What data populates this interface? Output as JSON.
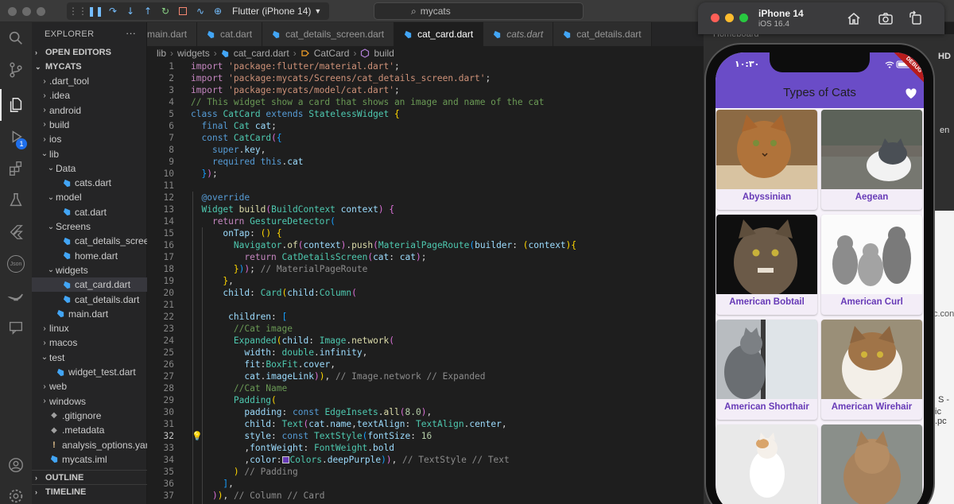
{
  "titlebar": {
    "device": "Flutter (iPhone 14)",
    "search_text": "mycats"
  },
  "activity": {
    "run_badge": "1",
    "json_label": "Json"
  },
  "sidebar": {
    "title": "EXPLORER",
    "more": "···",
    "open_editors": "OPEN EDITORS",
    "project": "MYCATS",
    "outline": "OUTLINE",
    "timeline": "TIMELINE",
    "tree": [
      {
        "label": ".dart_tool",
        "kind": "folder-closed"
      },
      {
        "label": ".idea",
        "kind": "folder-closed"
      },
      {
        "label": "android",
        "kind": "folder-closed"
      },
      {
        "label": "build",
        "kind": "folder-closed"
      },
      {
        "label": "ios",
        "kind": "folder-closed"
      },
      {
        "label": "lib",
        "kind": "folder-open"
      },
      {
        "label": "Data",
        "kind": "folder-open"
      },
      {
        "label": "cats.dart",
        "kind": "dart"
      },
      {
        "label": "model",
        "kind": "folder-open"
      },
      {
        "label": "cat.dart",
        "kind": "dart"
      },
      {
        "label": "Screens",
        "kind": "folder-open"
      },
      {
        "label": "cat_details_scree...",
        "kind": "dart"
      },
      {
        "label": "home.dart",
        "kind": "dart"
      },
      {
        "label": "widgets",
        "kind": "folder-open"
      },
      {
        "label": "cat_card.dart",
        "kind": "dart"
      },
      {
        "label": "cat_details.dart",
        "kind": "dart"
      },
      {
        "label": "main.dart",
        "kind": "dart"
      },
      {
        "label": "linux",
        "kind": "folder-closed"
      },
      {
        "label": "macos",
        "kind": "folder-closed"
      },
      {
        "label": "test",
        "kind": "folder-open"
      },
      {
        "label": "widget_test.dart",
        "kind": "dart"
      },
      {
        "label": "web",
        "kind": "folder-closed"
      },
      {
        "label": "windows",
        "kind": "folder-closed"
      },
      {
        "label": ".gitignore",
        "kind": "dot"
      },
      {
        "label": ".metadata",
        "kind": "dot"
      },
      {
        "label": "analysis_options.yaml",
        "kind": "bang"
      },
      {
        "label": "mycats.iml",
        "kind": "dart"
      }
    ]
  },
  "tabs": [
    {
      "label": "main.dart"
    },
    {
      "label": "cat.dart"
    },
    {
      "label": "cat_details_screen.dart"
    },
    {
      "label": "cat_card.dart"
    },
    {
      "label": "cats.dart"
    },
    {
      "label": "cat_details.dart"
    }
  ],
  "breadcrumb": {
    "p1": "lib",
    "p2": "widgets",
    "p3": "cat_card.dart",
    "p4": "CatCard",
    "p5": "build"
  },
  "code": {
    "line_numbers": [
      "1",
      "2",
      "3",
      "4",
      "5",
      "6",
      "7",
      "8",
      "9",
      "10",
      "11",
      "12",
      "13",
      "14",
      "15",
      "16",
      "17",
      "18",
      "19",
      "20",
      "21",
      "22",
      "23",
      "24",
      "25",
      "26",
      "27",
      "28",
      "29",
      "30",
      "31",
      "32",
      "33",
      "34",
      "35",
      "36",
      "37"
    ],
    "current_line": "32",
    "tokens": {
      "import": "import",
      "imp1": "'package:flutter/material.dart'",
      "imp2": "'package:mycats/Screens/cat_details_screen.dart'",
      "imp3": "'package:mycats/model/cat.dart'",
      "semi": ";",
      "comment4": "// This widget show a card that shows an image and name of the cat",
      "class": "class",
      "CatCard": "CatCard",
      "extends": "extends",
      "StatelessWidget": "StatelessWidget",
      "final": "final",
      "Cat": "Cat",
      "cat": "cat",
      "const": "const",
      "super": "super",
      "key": "key",
      "required": "required",
      "this": "this",
      "override": "@override",
      "Widget": "Widget",
      "build": "build",
      "BuildContext": "BuildContext",
      "context": "context",
      "return": "return",
      "GestureDetector": "GestureDetector",
      "onTap": "onTap",
      "Navigator": "Navigator",
      "of": "of",
      "push": "push",
      "MaterialPageRoute": "MaterialPageRoute",
      "builder": "builder",
      "CatDetailsScreen": "CatDetailsScreen",
      "hint18": "// MaterialPageRoute",
      "child": "child",
      "Card": "Card",
      "Column": "Column",
      "children": "children",
      "comment23": "//Cat image",
      "Expanded": "Expanded",
      "Image": "Image",
      "network": "network",
      "width": "width",
      "double": "double",
      "infinity": "infinity",
      "fit": "fit",
      "BoxFit": "BoxFit",
      "cover": "cover",
      "imageLink": "imageLink",
      "hint27": "// Image.network // Expanded",
      "comment28": "//Cat Name",
      "Padding": "Padding",
      "padding": "padding",
      "EdgeInsets": "EdgeInsets",
      "all": "all",
      "n8": "8.0",
      "Text": "Text",
      "name": "name",
      "textAlign": "textAlign",
      "TextAlign": "TextAlign",
      "center": "center",
      "style": "style",
      "TextStyle": "TextStyle",
      "fontSize": "fontSize",
      "n16": "16",
      "fontWeight": "fontWeight",
      "FontWeight": "FontWeight",
      "bold": "bold",
      "color": "color",
      "Colors": "Colors",
      "deepPurple": "deepPurple",
      "hint34": "// TextStyle // Text",
      "hint35": "// Padding",
      "hint37": "// Column // Card"
    }
  },
  "simulator": {
    "device": "iPhone 14",
    "os": "iOS 16.4",
    "status_time": "١٠:٣٠",
    "debug": "DEBUG",
    "app_title": "Types of Cats",
    "cats": [
      {
        "name": "Abyssinian"
      },
      {
        "name": "Aegean"
      },
      {
        "name": "American Bobtail"
      },
      {
        "name": "American Curl"
      },
      {
        "name": "American Shorthair"
      },
      {
        "name": "American Wirehair"
      },
      {
        "name": ""
      },
      {
        "name": ""
      }
    ],
    "accent": "#673ab7",
    "appbar_color": "#6a4cc7"
  },
  "background": {
    "t1": "Homeboard",
    "t2": "HD",
    "t3": "en",
    "t4": "c.con",
    "t5": "S -",
    "t6": "ic .pc"
  }
}
